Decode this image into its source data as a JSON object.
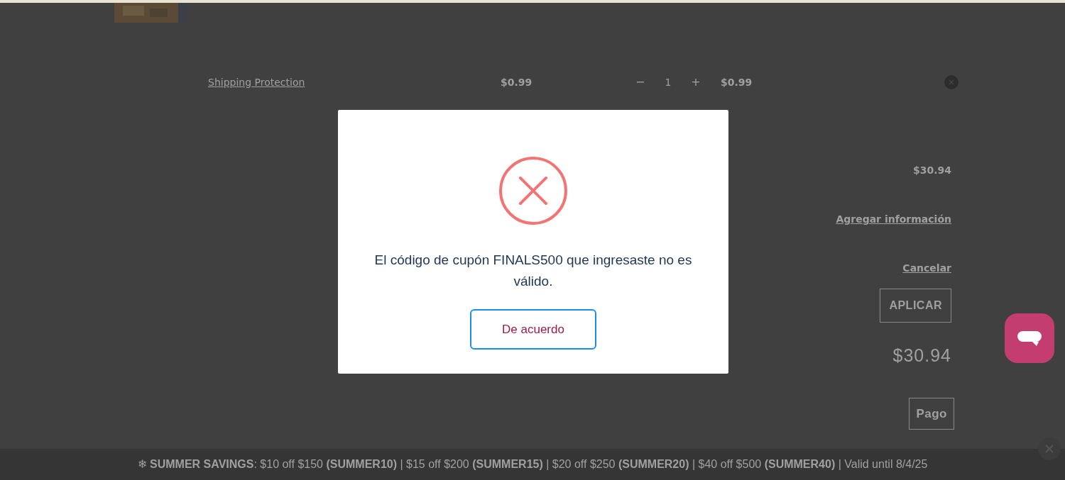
{
  "cart_item": {
    "name": "Shipping Protection",
    "price": "$0.99",
    "quantity": "1",
    "minus": "−",
    "plus": "+",
    "total": "$0.99"
  },
  "summary": {
    "subtotal": "$30.94",
    "add_info_link": "Agregar información",
    "cancel_link": "Cancelar",
    "apply_button": "APLICAR",
    "total": "$30.94",
    "checkout_button": "Pago"
  },
  "dialog": {
    "message": "El código de cupón FINALS500 que ingresaste no es válido.",
    "ok_button": "De acuerdo"
  },
  "promo_banner": {
    "text": "❄ **SUMMER SAVINGS**: $10 off $150 **(SUMMER10)** | $15 off $200 **(SUMMER15)** | $20 off $250 **(SUMMER20)** | $40 off $500 **(SUMMER40)** | Valid until 8/4/25"
  }
}
